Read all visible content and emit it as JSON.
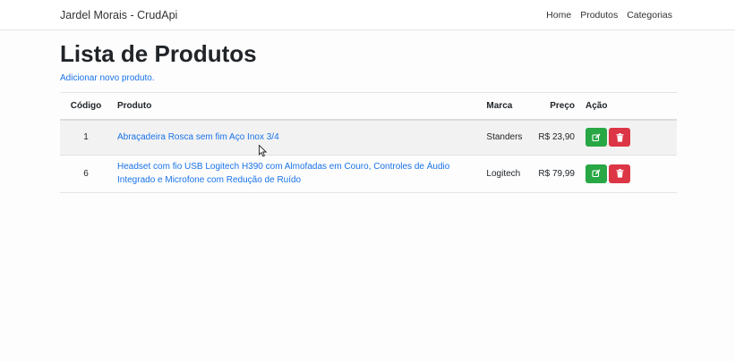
{
  "navbar": {
    "brand": "Jardel Morais - CrudApi",
    "links": [
      "Home",
      "Produtos",
      "Categorias"
    ]
  },
  "page": {
    "title": "Lista de Produtos",
    "add_link": "Adicionar novo produto."
  },
  "table": {
    "headers": [
      "Código",
      "Produto",
      "Marca",
      "Preço",
      "Ação"
    ],
    "rows": [
      {
        "code": "1",
        "product": "Abraçadeira Rosca sem fim Aço Inox 3/4",
        "brand": "Standers",
        "price": "R$ 23,90"
      },
      {
        "code": "6",
        "product": "Headset com fio USB Logitech H390 com Almofadas em Couro, Controles de Áudio Integrado e Microfone com Redução de Ruído",
        "brand": "Logitech",
        "price": "R$ 79,99"
      }
    ]
  },
  "colors": {
    "edit_button": "#28a745",
    "delete_button": "#dc3545",
    "link": "#1a73e8"
  },
  "icons": {
    "edit": "pencil-square-icon",
    "delete": "trash-icon"
  }
}
